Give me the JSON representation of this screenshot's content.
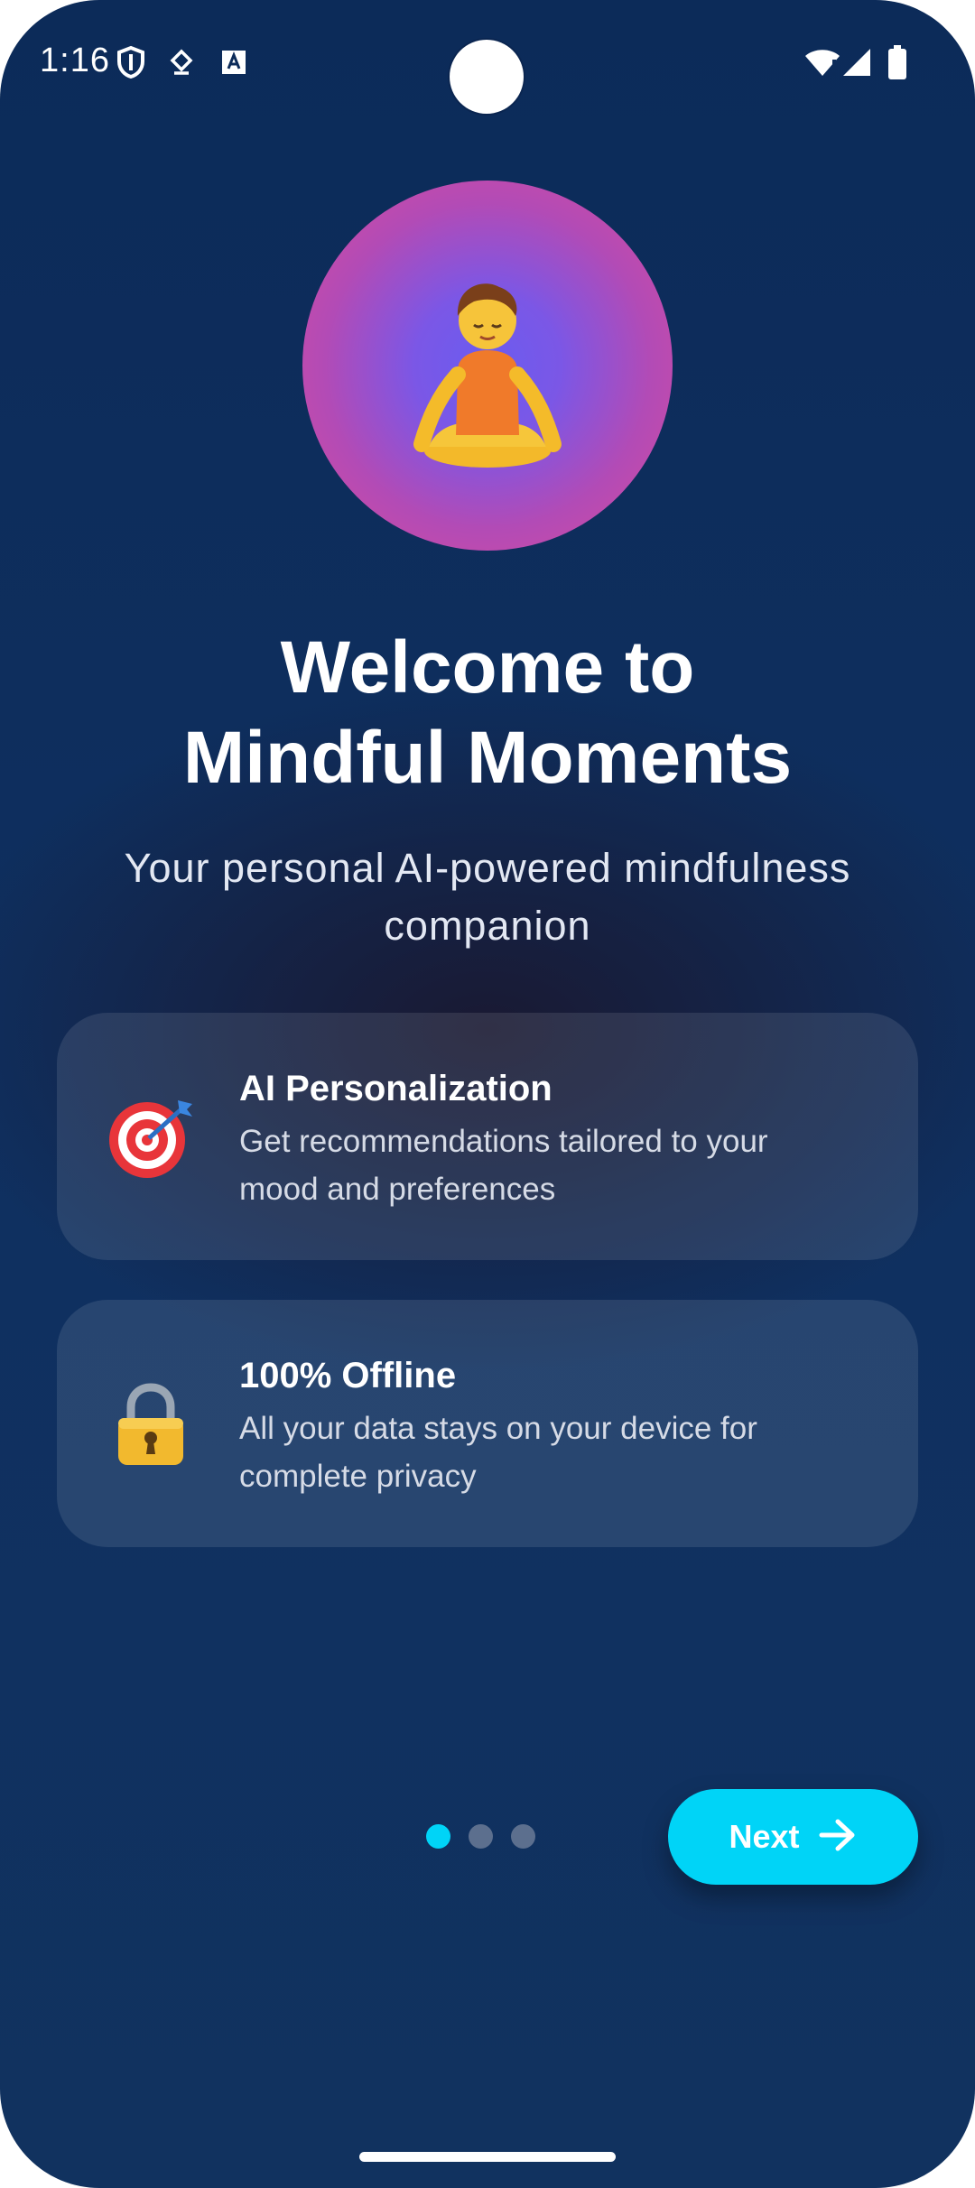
{
  "status_bar": {
    "time": "1:16",
    "icons": [
      "shield-icon",
      "pin-icon",
      "font-badge-icon",
      "wifi-alert-icon",
      "signal-icon",
      "battery-icon"
    ]
  },
  "hero": {
    "emoji": "🧘",
    "icon": "meditation-icon"
  },
  "welcome": {
    "title_line1": "Welcome to",
    "title_line2": "Mindful Moments",
    "subtitle_line1": "Your personal AI-powered mindfulness",
    "subtitle_line2": "companion"
  },
  "features": [
    {
      "icon": "target-icon",
      "emoji": "🎯",
      "title": "AI Personalization",
      "desc_line1": "Get recommendations tailored to your",
      "desc_line2": "mood and preferences"
    },
    {
      "icon": "lock-icon",
      "emoji": "🔒",
      "title": "100% Offline",
      "desc_line1": "All your data stays on your device for",
      "desc_line2": "complete privacy"
    }
  ],
  "pagination": {
    "total": 3,
    "current": 1,
    "active_color": "#00d4f7",
    "inactive_color": "#5c6f8e"
  },
  "next_button": {
    "label": "Next",
    "icon": "arrow-right-icon"
  },
  "colors": {
    "background": "#0f3060",
    "accent": "#00d4f7",
    "hero_pink": "#db4a9c",
    "hero_violet": "#6a5cf0"
  }
}
